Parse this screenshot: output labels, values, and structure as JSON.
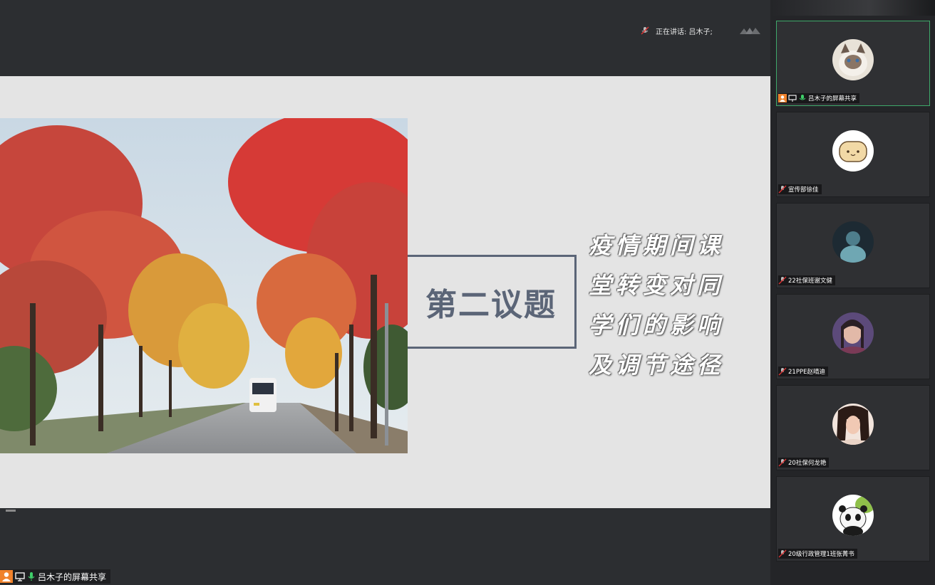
{
  "header": {
    "speaking_label": "正在讲话: 吕木子;"
  },
  "slide": {
    "topic_title": "第二议题",
    "topic_lines": [
      "疫情期间课",
      "堂转变对同",
      "学们的影响",
      "及调节途径"
    ]
  },
  "share_bar": {
    "label": "吕木子的屏幕共享"
  },
  "participants": [
    {
      "name": "吕木子的屏幕共享",
      "avatar": "cat-avatar",
      "active": true
    },
    {
      "name": "宣传部徐佳",
      "avatar": "bread-avatar",
      "active": false
    },
    {
      "name": "22社保班谢文健",
      "avatar": "dark-photo-avatar",
      "active": false
    },
    {
      "name": "21PPE赵晴迪",
      "avatar": "portrait-avatar",
      "active": false
    },
    {
      "name": "20社保何龙艳",
      "avatar": "portrait-avatar",
      "active": false
    },
    {
      "name": "20级行政管理1班张菁书",
      "avatar": "panda-avatar",
      "active": false
    }
  ],
  "colors": {
    "active_border": "#3fa86a",
    "slide_accent": "#5b6577",
    "sidebar_bg": "#242528"
  }
}
